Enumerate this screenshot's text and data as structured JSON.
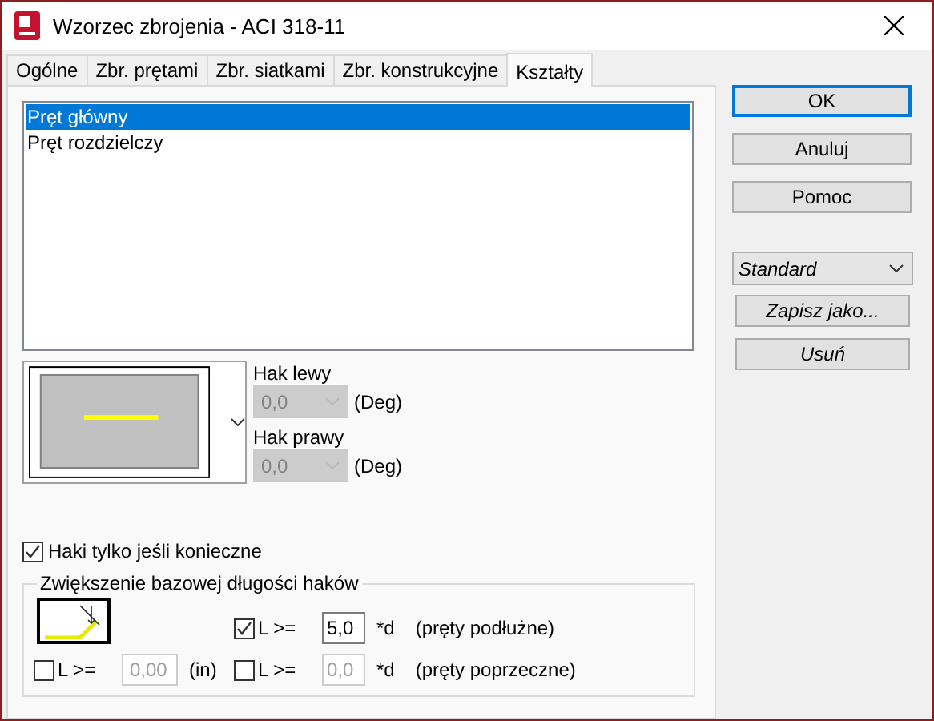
{
  "window": {
    "title": "Wzorzec zbrojenia - ACI 318-11"
  },
  "tabs": [
    {
      "label": "Ogólne",
      "selected": false
    },
    {
      "label": "Zbr. prętami",
      "selected": false
    },
    {
      "label": "Zbr. siatkami",
      "selected": false
    },
    {
      "label": "Zbr. konstrukcyjne",
      "selected": false
    },
    {
      "label": "Kształty",
      "selected": true
    }
  ],
  "shape_list": [
    {
      "label": "Pręt główny",
      "selected": true
    },
    {
      "label": "Pręt rozdzielczy",
      "selected": false
    }
  ],
  "hooks": [
    {
      "label": "Hak lewy",
      "value": "0,0",
      "unit": "(Deg)",
      "disabled": true
    },
    {
      "label": "Hak prawy",
      "value": "0,0",
      "unit": "(Deg)",
      "disabled": true
    }
  ],
  "hooks_only_if_needed": {
    "label": "Haki tylko jeśli konieczne",
    "checked": true
  },
  "extension": {
    "title": "Zwiększenie bazowej długości haków",
    "fields": [
      {
        "checked": true,
        "label": "L >=",
        "value": "5,0",
        "disabled": false,
        "suffix": "*d",
        "note": "(pręty podłużne)"
      },
      {
        "checked": false,
        "label": "L >=",
        "value": "0,00",
        "disabled": true,
        "suffix": "(in)"
      },
      {
        "checked": false,
        "label": "L >=",
        "value": "0,0",
        "disabled": true,
        "suffix": "*d",
        "note": "(pręty poprzeczne)"
      }
    ]
  },
  "buttons": [
    {
      "label": "OK",
      "default": true
    },
    {
      "label": "Anuluj",
      "default": false
    },
    {
      "label": "Pomoc",
      "default": false
    }
  ],
  "preset": {
    "value": "Standard"
  },
  "preset_buttons": [
    "Zapisz jako...",
    "Usuń"
  ]
}
